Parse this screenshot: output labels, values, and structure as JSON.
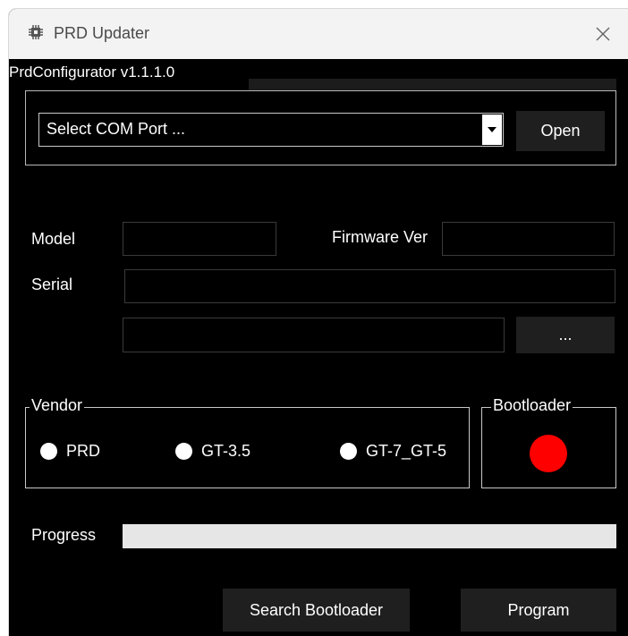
{
  "window": {
    "title": "PRD Updater",
    "icons": {
      "app": "chip-icon",
      "close": "close-icon"
    }
  },
  "header": {
    "label": "PrdConfigurator v1.1.1.0"
  },
  "com": {
    "select_value": "Select COM Port ...",
    "open_label": "Open"
  },
  "info": {
    "model_label": "Model",
    "model_value": "",
    "firmware_label": "Firmware Ver",
    "firmware_value": "",
    "serial_label": "Serial",
    "serial_value": "",
    "file_value": "",
    "browse_label": "..."
  },
  "vendor": {
    "title": "Vendor",
    "options": [
      "PRD",
      "GT-3.5",
      "GT-7_GT-5"
    ]
  },
  "bootloader": {
    "title": "Bootloader",
    "led_color": "#ff0000"
  },
  "progress": {
    "label": "Progress",
    "value_percent": 0
  },
  "actions": {
    "search_label": "Search Bootloader",
    "program_label": "Program"
  },
  "colors": {
    "background": "#000000",
    "button": "#1f1f1f",
    "titlebar": "#f3f3f3"
  }
}
